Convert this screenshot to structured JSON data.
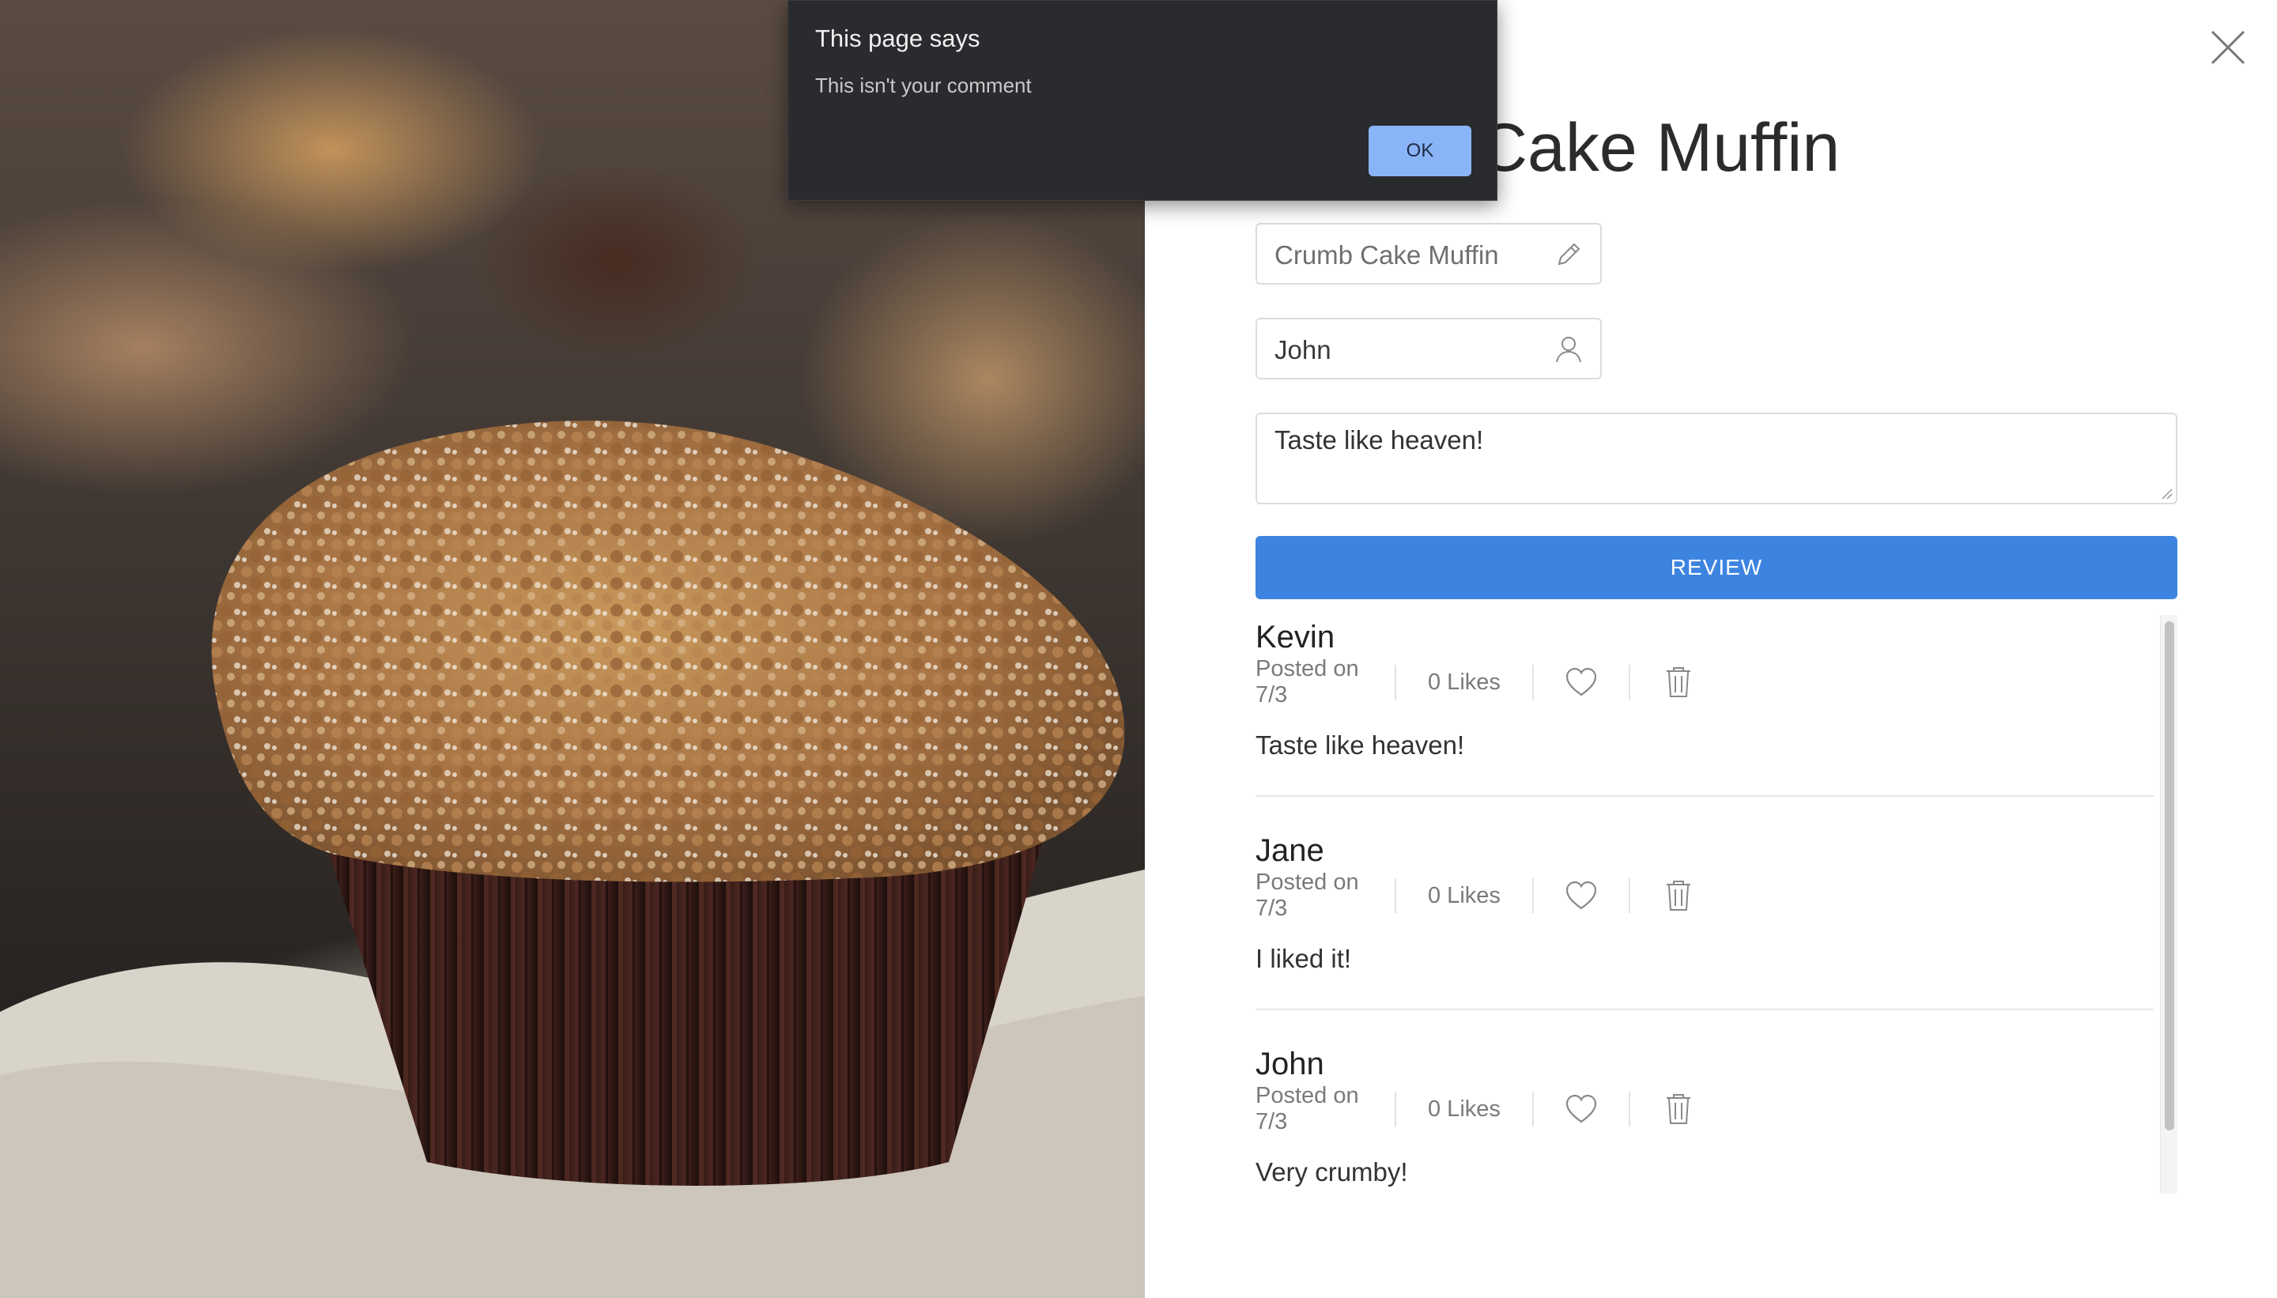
{
  "alert": {
    "title": "This page says",
    "message": "This isn't your comment",
    "ok_label": "OK",
    "ok_color": "#8ab4f8",
    "background": "#2a2b2e"
  },
  "product": {
    "title": "Crumb Cake Muffin",
    "image_alt": "crumb-cake-muffin-photo"
  },
  "form": {
    "name_value": "Crumb Cake Muffin",
    "user_value": "John",
    "comment_value": "Taste like heaven!",
    "submit_label": "REVIEW",
    "submit_color": "#3d84e0"
  },
  "comments": [
    {
      "author": "Kevin",
      "date": "Posted on 7/3",
      "likes": "0 Likes",
      "text": "Taste like heaven!"
    },
    {
      "author": "Jane",
      "date": "Posted on 7/3",
      "likes": "0 Likes",
      "text": "I liked it!"
    },
    {
      "author": "John",
      "date": "Posted on 7/3",
      "likes": "0 Likes",
      "text": "Very crumby!"
    }
  ],
  "icons": {
    "close": "close-icon",
    "edit": "pencil-icon",
    "user": "user-icon",
    "like": "heart-icon",
    "delete": "trash-icon"
  }
}
